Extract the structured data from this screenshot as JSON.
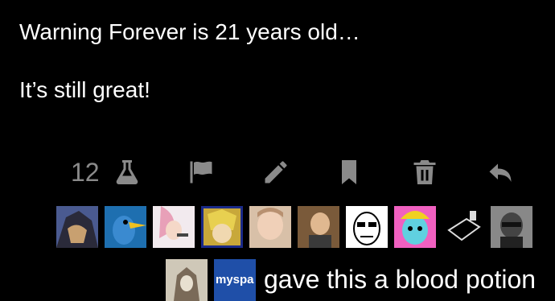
{
  "post": {
    "line1": "Warning Forever is 21 years old…",
    "line2": "It’s still great!"
  },
  "actions": {
    "like_count": "12",
    "icons": [
      "flask-icon",
      "flag-icon",
      "pencil-icon",
      "bookmark-icon",
      "trash-icon",
      "reply-icon"
    ],
    "icon_color": "#8a8a8a"
  },
  "avatars": [
    {
      "name": "avatar-1",
      "bg": "#5a6aa0"
    },
    {
      "name": "avatar-2",
      "bg": "#2e7fc0"
    },
    {
      "name": "avatar-3",
      "bg": "#e8dce0"
    },
    {
      "name": "avatar-4",
      "bg": "#3a4aa8"
    },
    {
      "name": "avatar-5",
      "bg": "#caa890"
    },
    {
      "name": "avatar-6",
      "bg": "#8a6a4a"
    },
    {
      "name": "avatar-7",
      "bg": "#f0f0f0"
    },
    {
      "name": "avatar-8",
      "bg": "#e040c0"
    },
    {
      "name": "avatar-9",
      "bg": "#111111"
    },
    {
      "name": "avatar-10",
      "bg": "#6a6a6a"
    }
  ],
  "gift": {
    "myspace_label": "myspa",
    "text": "gave this a blood potion"
  }
}
